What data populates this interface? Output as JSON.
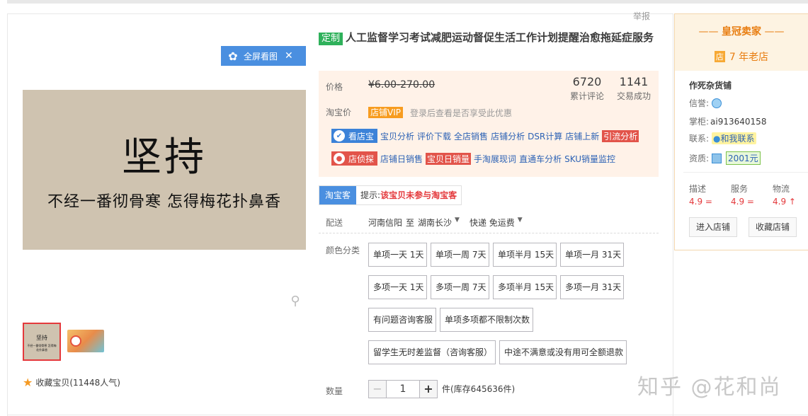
{
  "report_label": "举报",
  "gallery": {
    "fullscreen_label": "全屏看图",
    "main_image_big_text": "坚持",
    "main_image_small_text": "不经一番彻骨寒  怎得梅花扑鼻香",
    "thumb1_big": "坚持",
    "thumb1_small": "不经一番彻骨寒 怎得梅花扑鼻香",
    "favorite_label": "收藏宝贝",
    "favorite_count": "(11448人气)"
  },
  "title": {
    "tag": "定制",
    "text": "人工监督学习考试减肥运动督促生活工作计划提醒治愈拖延症服务"
  },
  "price": {
    "label": "价格",
    "value": "¥6.00-270.00",
    "reviews_count": "6720",
    "reviews_label": "累计评论",
    "deals_count": "1141",
    "deals_label": "交易成功",
    "taobao_label": "淘宝价",
    "vip_badge": "店铺VIP",
    "vip_note": "登录后查看是否享受此优惠"
  },
  "tools1": {
    "badge": "看店宝",
    "links": [
      "宝贝分析",
      "评价下载",
      "全店销售",
      "店铺分析",
      "DSR计算",
      "店铺上新",
      "引流分析"
    ]
  },
  "tools2": {
    "badge": "店侦探",
    "links": [
      "店铺日销售",
      "宝贝日销量",
      "手淘展现词",
      "直通车分析",
      "SKU销量监控"
    ]
  },
  "taobaoke": {
    "label": "淘宝客",
    "tip_prefix": "提示:",
    "tip": "该宝贝未参与淘宝客"
  },
  "delivery": {
    "label": "配送",
    "from": "河南信阳",
    "to_word": "至",
    "to": "湖南长沙",
    "shipping": "快递 免运费"
  },
  "options": {
    "label": "颜色分类",
    "items": [
      "单项一天 1天",
      "单项一周 7天",
      "单项半月 15天",
      "单项一月 31天",
      "多项一天 1天",
      "多项一周 7天",
      "多项半月 15天",
      "多项一月 31天",
      "有问题咨询客服",
      "单项多项都不限制次数",
      "留学生无时差监督（咨询客服）",
      "中途不满意或没有用可全额退款"
    ]
  },
  "quantity": {
    "label": "数量",
    "minus": "−",
    "value": "1",
    "plus": "+",
    "stock": "件(库存645636件)"
  },
  "watermark": "知乎 @花和尚",
  "seller": {
    "crown": "皇冠卖家",
    "store_icon": "店",
    "years": "7 年老店",
    "name": "作死杂货铺",
    "credit_label": "信誉:",
    "wangwang_label": "掌柜:",
    "wangwang": "ai913640158",
    "contact_label": "联系:",
    "contact": "和我联系",
    "qual_label": "资质:",
    "deposit": "2001元",
    "scores": [
      {
        "k": "描述",
        "v": "4.9 ="
      },
      {
        "k": "服务",
        "v": "4.9 ="
      },
      {
        "k": "物流",
        "v": "4.9 ↑"
      }
    ],
    "enter_store": "进入店铺",
    "fav_store": "收藏店铺"
  },
  "colors": {
    "accent_blue": "#4a8fe0",
    "price_bg": "#fff2e8",
    "brand_orange": "#e87d10",
    "red": "#e4393c",
    "green_tag": "#2fb15b"
  }
}
